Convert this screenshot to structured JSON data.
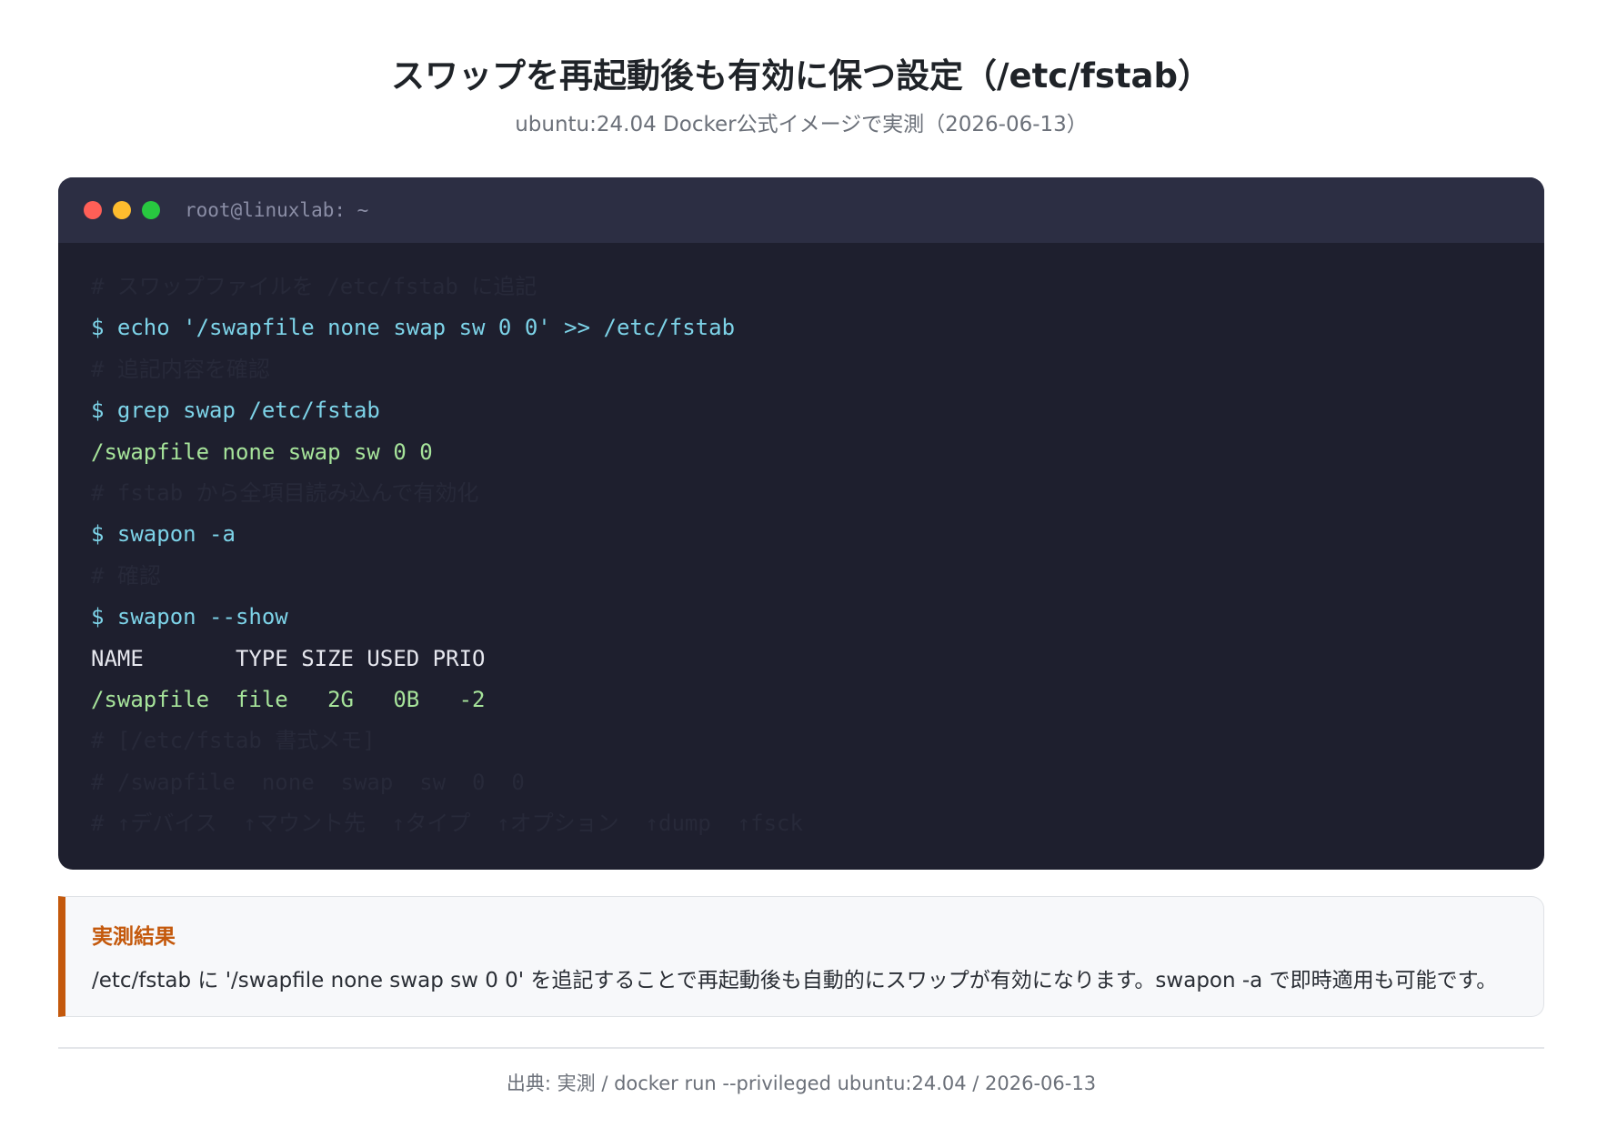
{
  "header": {
    "title": "スワップを再起動後も有効に保つ設定（/etc/fstab）",
    "subtitle": "ubuntu:24.04 Docker公式イメージで実測（2026-06-13）"
  },
  "terminal": {
    "window_title": "root@linuxlab: ~",
    "lines": [
      {
        "kind": "comment",
        "text": "# スワップファイルを /etc/fstab に追記"
      },
      {
        "kind": "cmd",
        "text": "$ echo '/swapfile none swap sw 0 0' >> /etc/fstab"
      },
      {
        "kind": "comment",
        "text": "# 追記内容を確認"
      },
      {
        "kind": "cmd",
        "text": "$ grep swap /etc/fstab"
      },
      {
        "kind": "out-green",
        "text": "/swapfile none swap sw 0 0"
      },
      {
        "kind": "comment",
        "text": "# fstab から全項目読み込んで有効化"
      },
      {
        "kind": "cmd",
        "text": "$ swapon -a"
      },
      {
        "kind": "comment",
        "text": "# 確認"
      },
      {
        "kind": "cmd",
        "text": "$ swapon --show"
      },
      {
        "kind": "out-plain",
        "text": "NAME       TYPE SIZE USED PRIO"
      },
      {
        "kind": "out-green",
        "text": "/swapfile  file   2G   0B   -2"
      },
      {
        "kind": "comment",
        "text": "# [/etc/fstab 書式メモ]"
      },
      {
        "kind": "comment",
        "text": "# /swapfile  none  swap  sw  0  0"
      },
      {
        "kind": "comment",
        "text": "# ↑デバイス  ↑マウント先  ↑タイプ  ↑オプション  ↑dump  ↑fsck"
      }
    ]
  },
  "callout": {
    "title": "実測結果",
    "text": "/etc/fstab に '/swapfile none swap sw 0 0' を追記することで再起動後も自動的にスワップが有効になります。swapon -a で即時適用も可能です。"
  },
  "footer": {
    "source": "出典: 実測 / docker run --privileged ubuntu:24.04 / 2026-06-13"
  },
  "colors": {
    "accent": "#c4590c",
    "terminal_bg": "#1e1f2e",
    "cmd": "#7dd3e8",
    "output_green": "#a6e39a"
  }
}
